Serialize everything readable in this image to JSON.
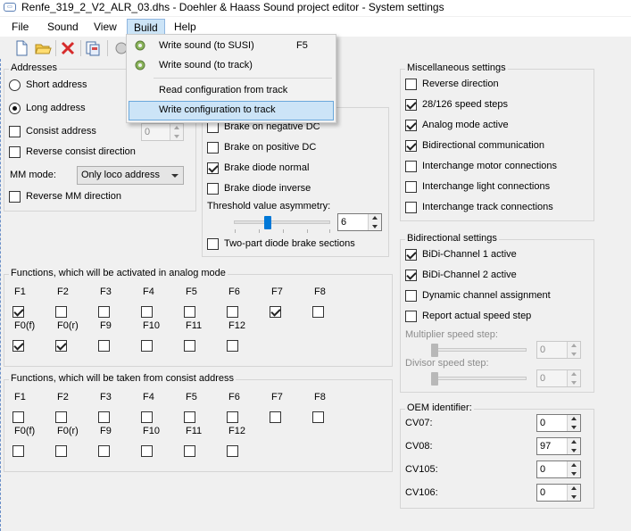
{
  "window": {
    "title": "Renfe_319_2_V2_ALR_03.dhs - Doehler & Haass Sound project editor - System settings"
  },
  "menubar": {
    "items": [
      "File",
      "Sound",
      "View",
      "Build",
      "Help"
    ]
  },
  "build_menu": {
    "items": [
      {
        "label": "Write sound (to SUSI)",
        "shortcut": "F5"
      },
      {
        "label": "Write sound (to track)",
        "shortcut": ""
      },
      {
        "label": "Read configuration from track",
        "shortcut": ""
      },
      {
        "label": "Write configuration to track",
        "shortcut": ""
      }
    ]
  },
  "addresses": {
    "title": "Addresses",
    "short_address": "Short address",
    "long_address": "Long address",
    "consist_address": "Consist address",
    "consist_value": "0",
    "reverse_consist": "Reverse consist direction",
    "mm_mode_label": "MM mode:",
    "mm_mode_value": "Only loco address",
    "reverse_mm": "Reverse MM direction"
  },
  "brake": {
    "neg_dc": "Brake on negative DC",
    "pos_dc": "Brake on positive DC",
    "diode_normal": "Brake diode normal",
    "diode_inverse": "Brake diode inverse",
    "threshold_label": "Threshold value asymmetry:",
    "threshold_value": "6",
    "threshold_level": 0.35,
    "two_part": "Two-part diode brake sections"
  },
  "functions_analog": {
    "title": "Functions, which will be activated in analog mode",
    "row1": [
      "F1",
      "F2",
      "F3",
      "F4",
      "F5",
      "F6",
      "F7",
      "F8"
    ],
    "row1_checked": [
      true,
      false,
      false,
      false,
      false,
      false,
      true,
      false
    ],
    "row2": [
      "F0(f)",
      "F0(r)",
      "F9",
      "F10",
      "F11",
      "F12"
    ],
    "row2_checked": [
      true,
      true,
      false,
      false,
      false,
      false
    ]
  },
  "functions_consist": {
    "title": "Functions, which will be taken from consist address",
    "row1": [
      "F1",
      "F2",
      "F3",
      "F4",
      "F5",
      "F6",
      "F7",
      "F8"
    ],
    "row1_checked": [
      false,
      false,
      false,
      false,
      false,
      false,
      false,
      false
    ],
    "row2": [
      "F0(f)",
      "F0(r)",
      "F9",
      "F10",
      "F11",
      "F12"
    ],
    "row2_checked": [
      false,
      false,
      false,
      false,
      false,
      false
    ]
  },
  "misc": {
    "title": "Miscellaneous settings",
    "items": [
      {
        "label": "Reverse direction",
        "checked": false
      },
      {
        "label": "28/126 speed steps",
        "checked": true
      },
      {
        "label": "Analog mode active",
        "checked": true
      },
      {
        "label": "Bidirectional communication",
        "checked": true
      },
      {
        "label": "Interchange motor connections",
        "checked": false
      },
      {
        "label": "Interchange light connections",
        "checked": false
      },
      {
        "label": "Interchange track connections",
        "checked": false
      }
    ]
  },
  "bidi": {
    "title": "Bidirectional settings",
    "items": [
      {
        "label": "BiDi-Channel 1 active",
        "checked": true
      },
      {
        "label": "BiDi-Channel 2 active",
        "checked": true
      },
      {
        "label": "Dynamic channel assignment",
        "checked": false
      },
      {
        "label": "Report actual speed step",
        "checked": false
      }
    ],
    "multiplier_label": "Multiplier speed step:",
    "multiplier_value": "0",
    "divisor_label": "Divisor speed step:",
    "divisor_value": "0"
  },
  "oem": {
    "title": "OEM identifier:",
    "rows": [
      {
        "label": "CV07:",
        "value": "0"
      },
      {
        "label": "CV08:",
        "value": "97"
      },
      {
        "label": "CV105:",
        "value": "0"
      },
      {
        "label": "CV106:",
        "value": "0"
      }
    ]
  }
}
